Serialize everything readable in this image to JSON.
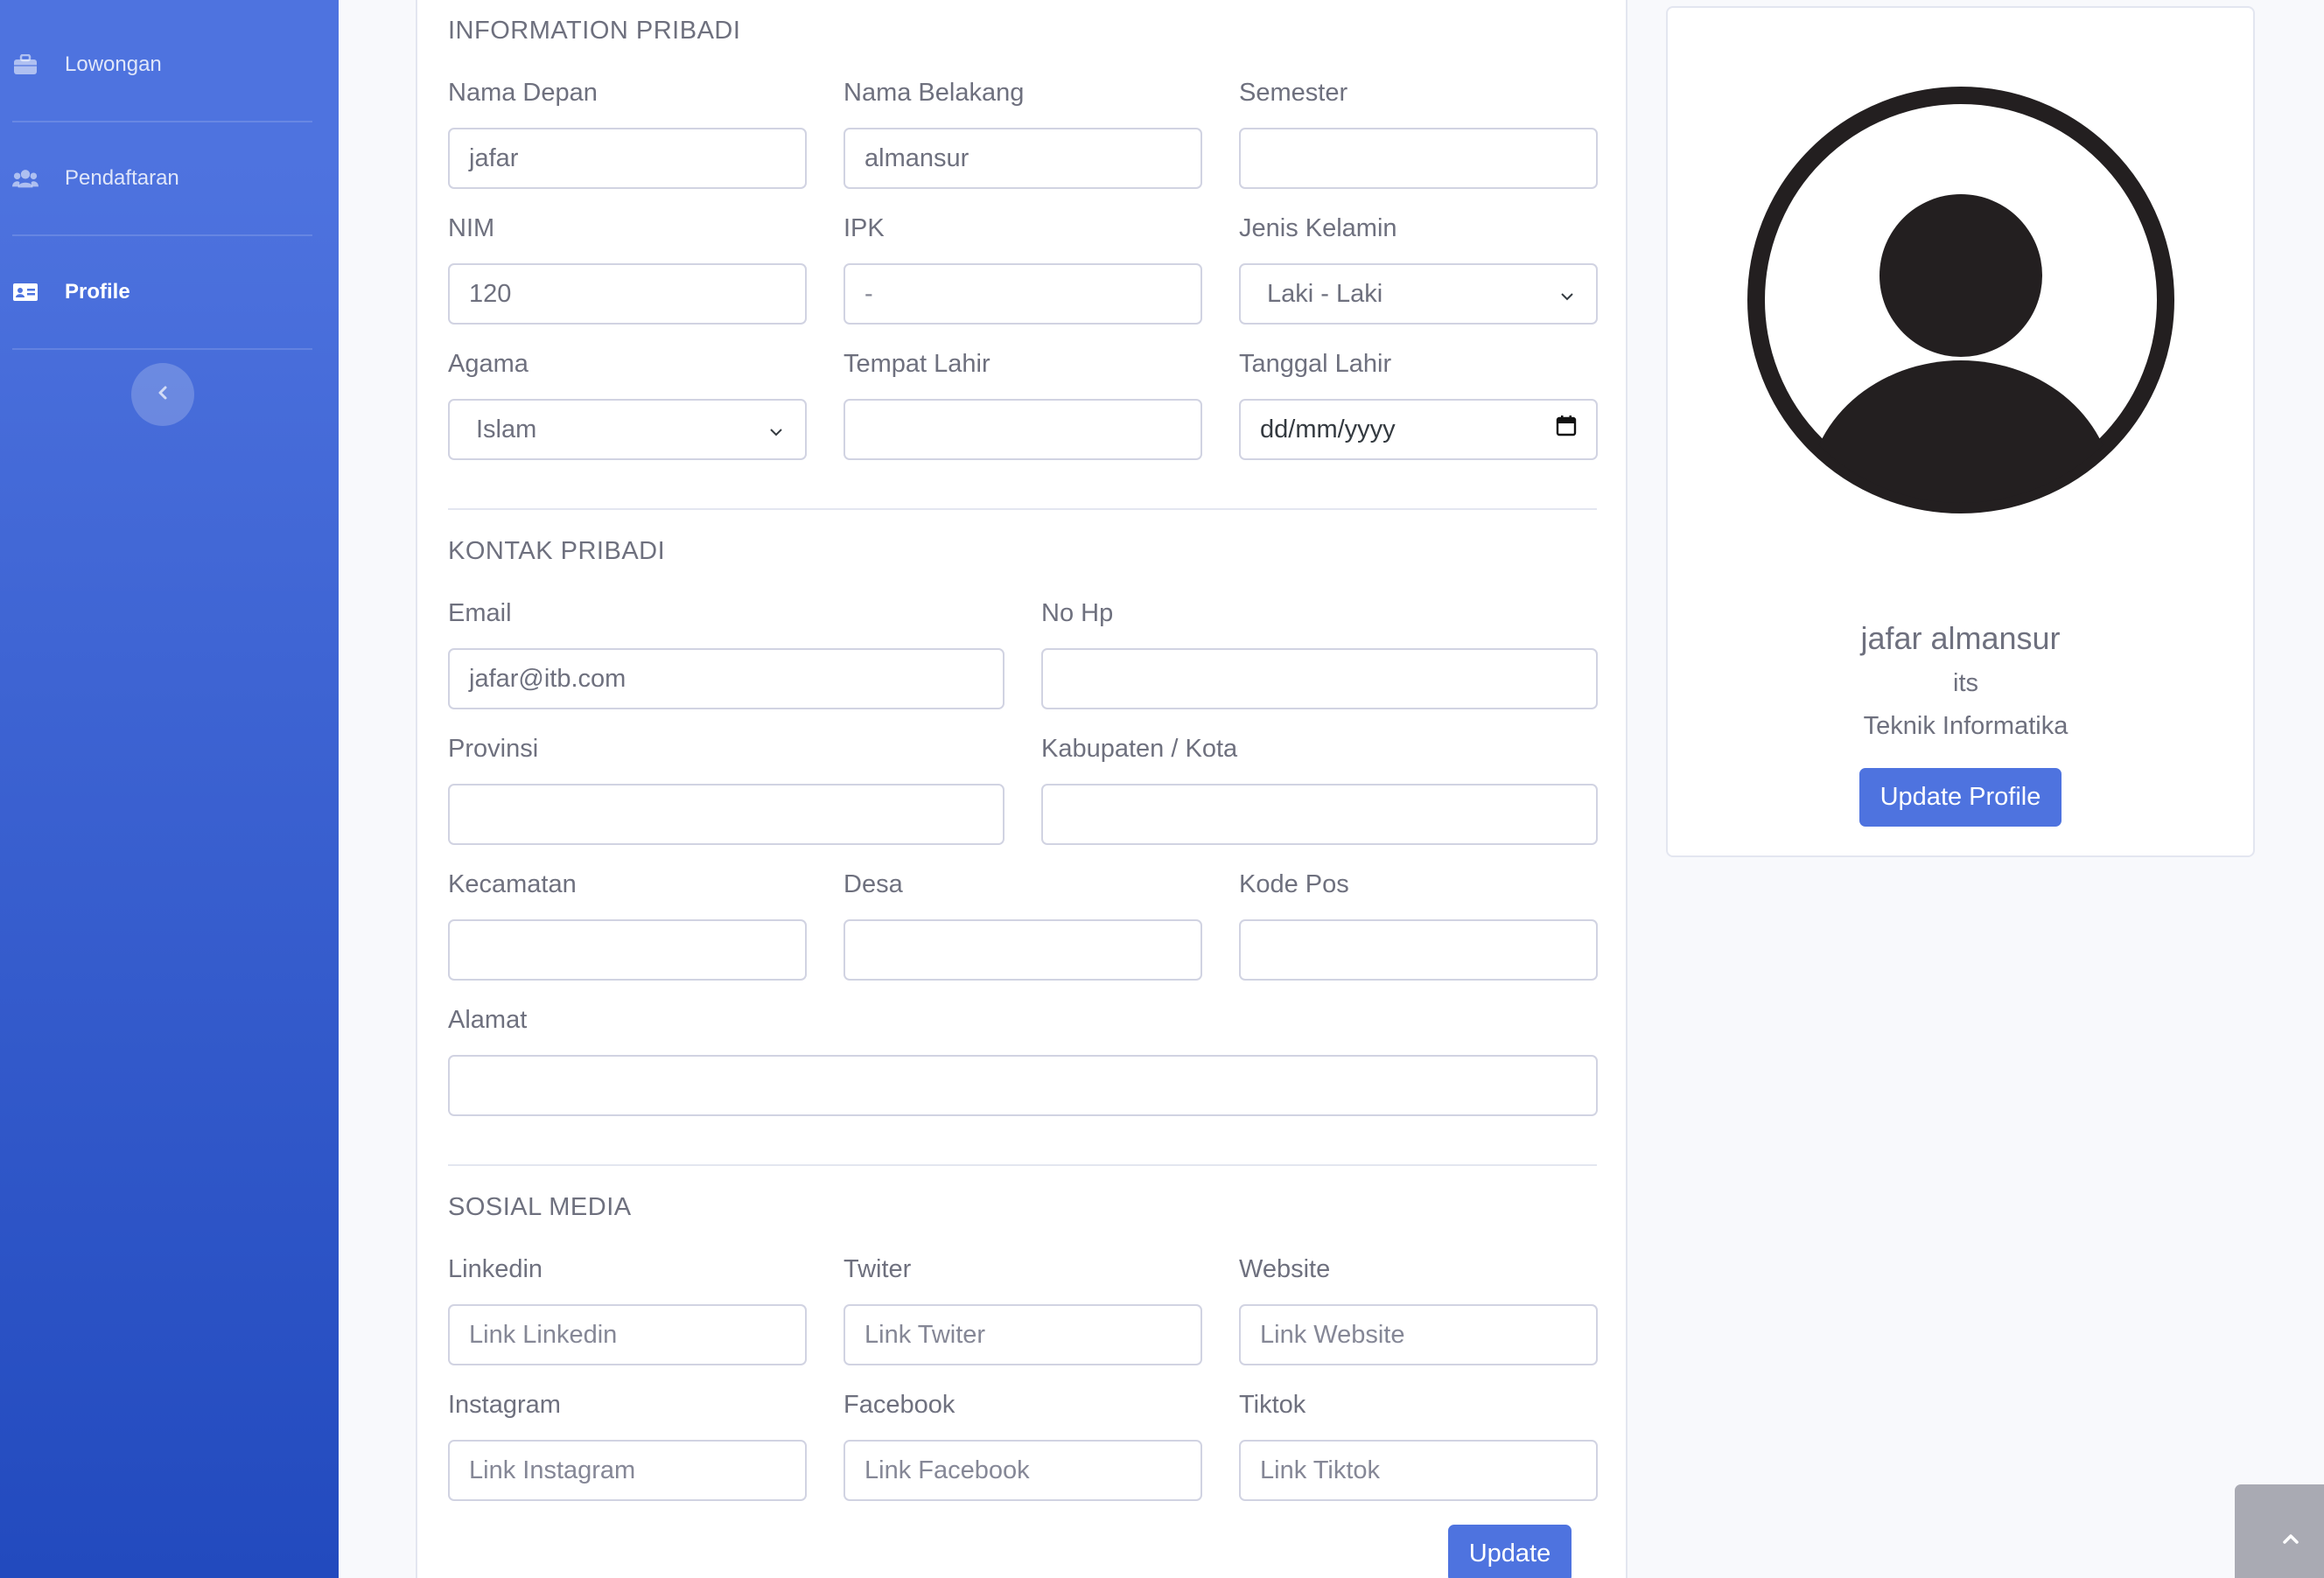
{
  "sidebar": {
    "items": [
      {
        "label": "Lowongan",
        "icon": "briefcase-icon",
        "active": false
      },
      {
        "label": "Pendaftaran",
        "icon": "users-icon",
        "active": false
      },
      {
        "label": "Profile",
        "icon": "id-card-icon",
        "active": true
      }
    ],
    "toggle_icon": "chevron-left-icon"
  },
  "form": {
    "sections": {
      "personal": "INFORMATION PRIBADI",
      "contact": "KONTAK PRIBADI",
      "social": "SOSIAL MEDIA"
    },
    "fields": {
      "nama_depan": {
        "label": "Nama Depan",
        "value": "jafar"
      },
      "nama_belakang": {
        "label": "Nama Belakang",
        "value": "almansur"
      },
      "semester": {
        "label": "Semester",
        "value": ""
      },
      "nim": {
        "label": "NIM",
        "value": "120"
      },
      "ipk": {
        "label": "IPK",
        "value": "-"
      },
      "jenis_kelamin": {
        "label": "Jenis Kelamin",
        "value": "Laki - Laki"
      },
      "agama": {
        "label": "Agama",
        "value": "Islam"
      },
      "tempat_lahir": {
        "label": "Tempat Lahir",
        "value": ""
      },
      "tanggal_lahir": {
        "label": "Tanggal Lahir",
        "placeholder": "dd/mm/yyyy"
      },
      "email": {
        "label": "Email",
        "value": "jafar@itb.com"
      },
      "no_hp": {
        "label": "No Hp",
        "value": ""
      },
      "provinsi": {
        "label": "Provinsi",
        "value": ""
      },
      "kabupaten": {
        "label": "Kabupaten / Kota",
        "value": ""
      },
      "kecamatan": {
        "label": "Kecamatan",
        "value": ""
      },
      "desa": {
        "label": "Desa",
        "value": ""
      },
      "kode_pos": {
        "label": "Kode Pos",
        "value": ""
      },
      "alamat": {
        "label": "Alamat",
        "value": ""
      },
      "linkedin": {
        "label": "Linkedin",
        "placeholder": "Link Linkedin"
      },
      "twiter": {
        "label": "Twiter",
        "placeholder": "Link Twiter"
      },
      "website": {
        "label": "Website",
        "placeholder": "Link Website"
      },
      "instagram": {
        "label": "Instagram",
        "placeholder": "Link Instagram"
      },
      "facebook": {
        "label": "Facebook",
        "placeholder": "Link Facebook"
      },
      "tiktok": {
        "label": "Tiktok",
        "placeholder": "Link Tiktok"
      }
    },
    "update_button": "Update"
  },
  "profile": {
    "name": "jafar almansur",
    "university": "its",
    "major": "Teknik Informatika",
    "update_button": "Update Profile",
    "avatar_icon": "user-avatar-icon"
  },
  "scroll_top_icon": "chevron-up-icon",
  "colors": {
    "primary": "#4e73df",
    "sidebar_gradient_top": "#4e73df",
    "sidebar_gradient_bottom": "#224abe",
    "avatar": "#231f20"
  }
}
